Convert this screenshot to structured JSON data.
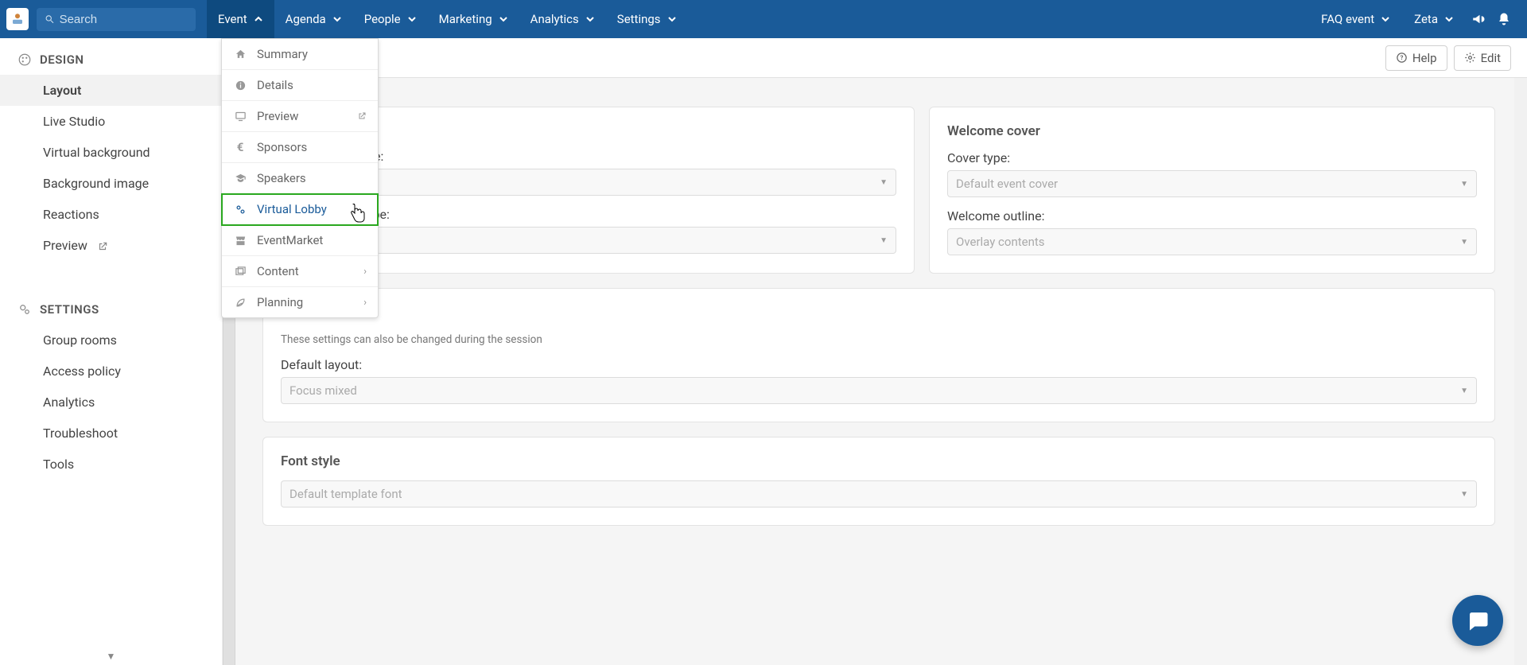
{
  "topnav": {
    "search_placeholder": "Search",
    "items": [
      "Event",
      "Agenda",
      "People",
      "Marketing",
      "Analytics",
      "Settings"
    ],
    "right_items": [
      "FAQ event",
      "Zeta"
    ]
  },
  "subheader": {
    "help_label": "Help",
    "edit_label": "Edit"
  },
  "sidebar": {
    "section1_title": "DESIGN",
    "section1_items": [
      "Layout",
      "Live Studio",
      "Virtual background",
      "Background image",
      "Reactions",
      "Preview"
    ],
    "section2_title": "SETTINGS",
    "section2_items": [
      "Group rooms",
      "Access policy",
      "Analytics",
      "Troubleshoot",
      "Tools"
    ]
  },
  "dropdown": {
    "items": [
      {
        "icon": "home",
        "label": "Summary"
      },
      {
        "icon": "info",
        "label": "Details"
      },
      {
        "icon": "monitor",
        "label": "Preview",
        "external": true
      },
      {
        "icon": "euro",
        "label": "Sponsors"
      },
      {
        "icon": "grad",
        "label": "Speakers"
      },
      {
        "icon": "cogs",
        "label": "Virtual Lobby",
        "highlight": true
      },
      {
        "icon": "store",
        "label": "EventMarket"
      },
      {
        "icon": "images",
        "label": "Content",
        "submenu": true
      },
      {
        "icon": "leaf",
        "label": "Planning",
        "submenu": true
      }
    ]
  },
  "content": {
    "info_card": {
      "title_fragment": "",
      "bg_type_label_fragment": "pe:",
      "dec_type_label_fragment": "ype:"
    },
    "welcome_card": {
      "title": "Welcome cover",
      "cover_type_label": "Cover type:",
      "cover_type_value": "Default event cover",
      "outline_label": "Welcome outline:",
      "outline_value": "Overlay contents"
    },
    "layout_card": {
      "hint": "These settings can also be changed during the session",
      "default_layout_label": "Default layout:",
      "default_layout_value": "Focus mixed"
    },
    "font_card": {
      "title": "Font style",
      "value": "Default template font"
    }
  }
}
